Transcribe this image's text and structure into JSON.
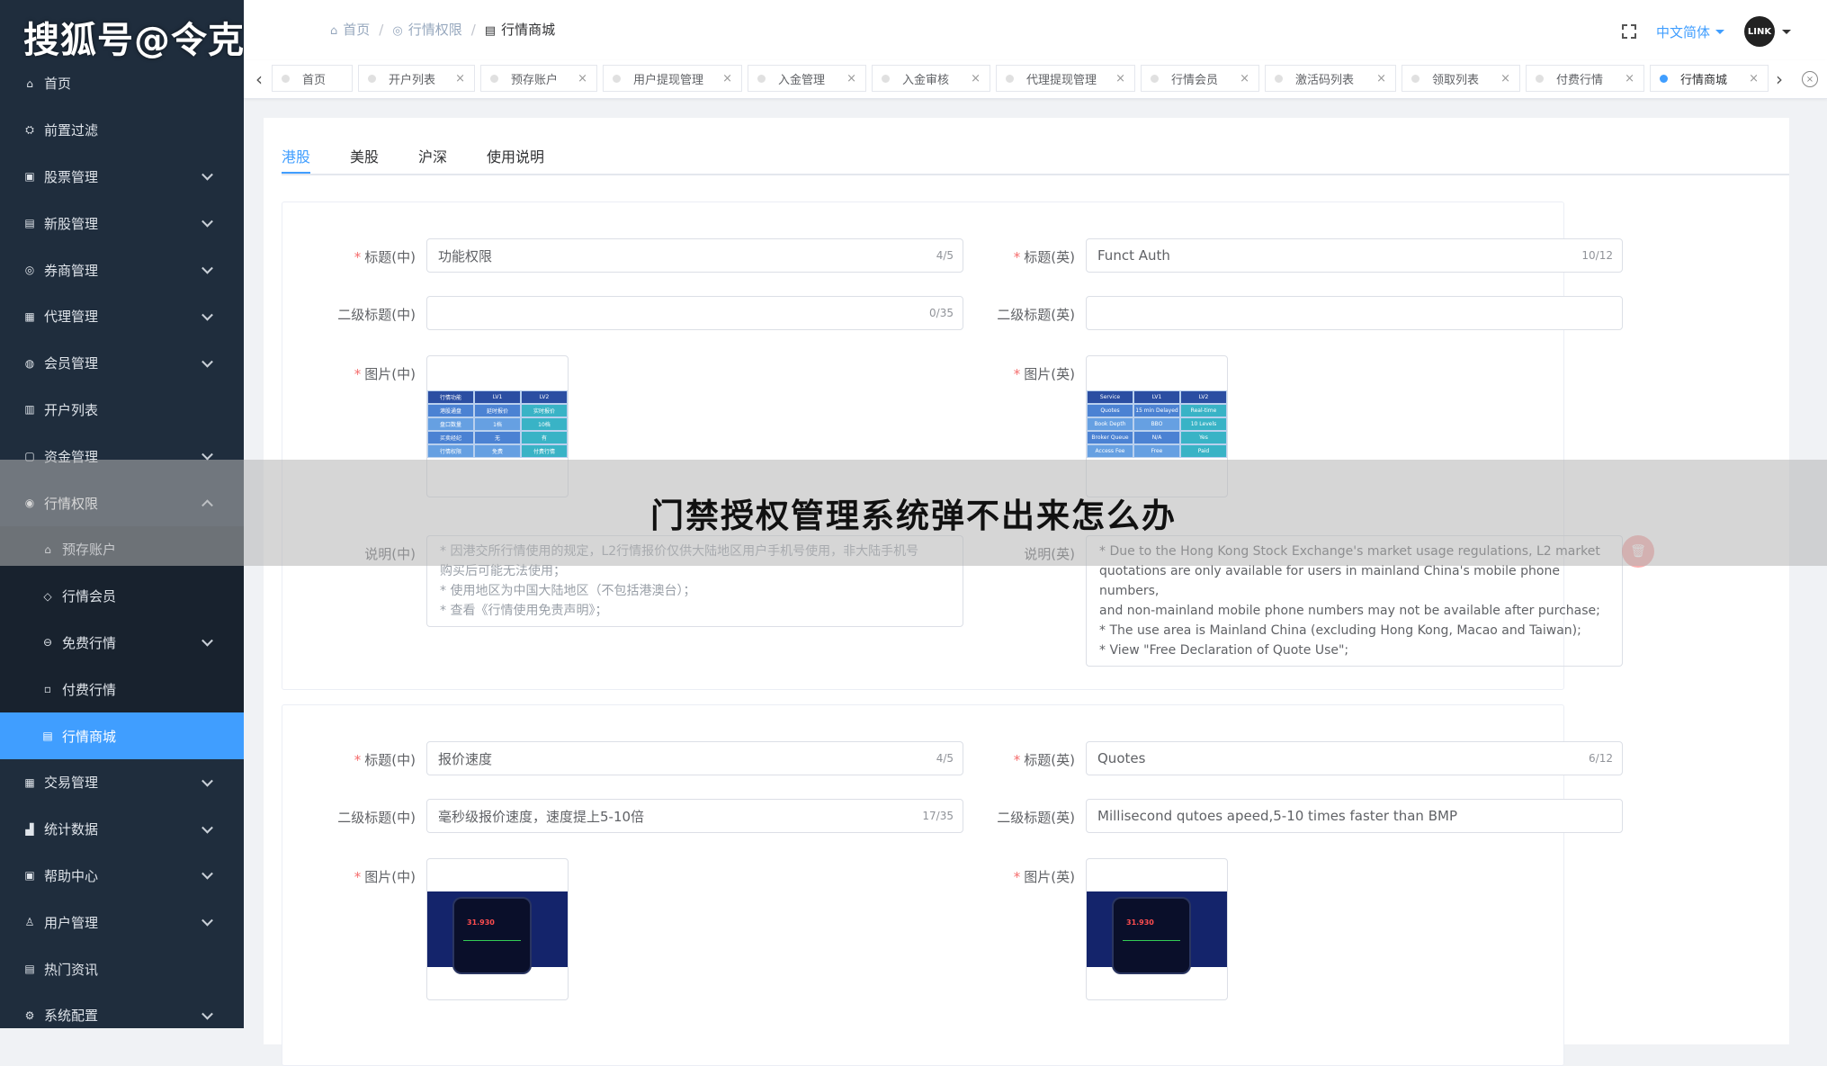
{
  "watermark": "搜狐号@令克软件",
  "overlay_title": "门禁授权管理系统弹不出来怎么办",
  "sidebar": {
    "items": [
      {
        "label": "首页",
        "icon": "home-icon",
        "glyph": "⌂",
        "chevron": false
      },
      {
        "label": "前置过滤",
        "icon": "filter-icon",
        "glyph": "⛭",
        "chevron": false
      },
      {
        "label": "股票管理",
        "icon": "stock-icon",
        "glyph": "▣",
        "chevron": true
      },
      {
        "label": "新股管理",
        "icon": "ipo-icon",
        "glyph": "▤",
        "chevron": true
      },
      {
        "label": "券商管理",
        "icon": "broker-icon",
        "glyph": "◎",
        "chevron": true
      },
      {
        "label": "代理管理",
        "icon": "agent-icon",
        "glyph": "▦",
        "chevron": true
      },
      {
        "label": "会员管理",
        "icon": "member-icon",
        "glyph": "◍",
        "chevron": true
      },
      {
        "label": "开户列表",
        "icon": "account-list-icon",
        "glyph": "▥",
        "chevron": false
      },
      {
        "label": "资金管理",
        "icon": "fund-icon",
        "glyph": "▢",
        "chevron": true
      },
      {
        "label": "行情权限",
        "icon": "quote-permission-icon",
        "glyph": "◉",
        "chevron": "up",
        "open": true
      },
      {
        "label": "预存账户",
        "icon": "prestore-icon",
        "glyph": "⌂",
        "sub": true
      },
      {
        "label": "行情会员",
        "icon": "quote-member-icon",
        "glyph": "◇",
        "sub": true
      },
      {
        "label": "免费行情",
        "icon": "free-quote-icon",
        "glyph": "⊖",
        "sub": true,
        "chevron": true
      },
      {
        "label": "付费行情",
        "icon": "paid-quote-icon",
        "glyph": "▫",
        "sub": true
      },
      {
        "label": "行情商城",
        "icon": "quote-mall-icon",
        "glyph": "▤",
        "sub": true,
        "active": true
      },
      {
        "label": "交易管理",
        "icon": "trade-icon",
        "glyph": "▦",
        "chevron": true
      },
      {
        "label": "统计数据",
        "icon": "stats-icon",
        "glyph": "▟",
        "chevron": true
      },
      {
        "label": "帮助中心",
        "icon": "help-icon",
        "glyph": "▣",
        "chevron": true
      },
      {
        "label": "用户管理",
        "icon": "user-icon",
        "glyph": "♙",
        "chevron": true
      },
      {
        "label": "热门资讯",
        "icon": "news-icon",
        "glyph": "▤",
        "chevron": false
      },
      {
        "label": "系统配置",
        "icon": "settings-icon",
        "glyph": "⚙",
        "chevron": true
      }
    ]
  },
  "breadcrumb": [
    {
      "label": "首页",
      "glyph": "⌂"
    },
    {
      "label": "行情权限",
      "glyph": "◎"
    },
    {
      "label": "行情商城",
      "glyph": "▤"
    }
  ],
  "header": {
    "language": "中文简体",
    "avatar_text": "LINK"
  },
  "tags": [
    {
      "label": "首页",
      "closable": false,
      "width": 90
    },
    {
      "label": "开户列表",
      "closable": true,
      "width": 130
    },
    {
      "label": "预存账户",
      "closable": true,
      "width": 130
    },
    {
      "label": "用户提现管理",
      "closable": true,
      "width": 155
    },
    {
      "label": "入金管理",
      "closable": true,
      "width": 132
    },
    {
      "label": "入金审核",
      "closable": true,
      "width": 132
    },
    {
      "label": "代理提现管理",
      "closable": true,
      "width": 155
    },
    {
      "label": "行情会员",
      "closable": true,
      "width": 132
    },
    {
      "label": "激活码列表",
      "closable": true,
      "width": 146
    },
    {
      "label": "领取列表",
      "closable": true,
      "width": 132
    },
    {
      "label": "付费行情",
      "closable": true,
      "width": 132
    },
    {
      "label": "行情商城",
      "closable": true,
      "width": 132,
      "active": true
    }
  ],
  "tabs": [
    {
      "label": "港股",
      "active": true
    },
    {
      "label": "美股"
    },
    {
      "label": "沪深"
    },
    {
      "label": "使用说明"
    }
  ],
  "labels": {
    "title_cn": "标题(中)",
    "title_en": "标题(英)",
    "subtitle_cn": "二级标题(中)",
    "subtitle_en": "二级标题(英)",
    "image_cn": "图片(中)",
    "image_en": "图片(英)",
    "desc_cn": "说明(中)",
    "desc_en": "说明(英)",
    "required_mark": "*"
  },
  "sections": [
    {
      "title_cn": {
        "value": "功能权限",
        "count": "4/5"
      },
      "title_en": {
        "value": "Funct Auth",
        "count": "10/12"
      },
      "subtitle_cn": {
        "value": "",
        "count": "0/35"
      },
      "subtitle_en": {
        "value": "",
        "count": ""
      },
      "desc_cn": [
        "* 因港交所行情使用的规定，L2行情报价仅供大陆地区用户手机号使用，非大陆手机号",
        "购买后可能无法使用；",
        "* 使用地区为中国大陆地区（不包括港澳台）；",
        "* 查看《行情使用免责声明》；"
      ],
      "desc_en": [
        "* Due to the Hong Kong Stock Exchange's market usage regulations, L2 market",
        "quotations are only available for users in mainland China's mobile phone numbers,",
        "and non-mainland mobile phone numbers may not be available after purchase;",
        "* The use area is Mainland China (excluding Hong Kong, Macao and Taiwan);",
        "* View \"Free Declaration of Quote Use\";"
      ]
    },
    {
      "title_cn": {
        "value": "报价速度",
        "count": "4/5"
      },
      "title_en": {
        "value": "Quotes",
        "count": "6/12"
      },
      "subtitle_cn": {
        "value": "毫秒级报价速度，速度提上5-10倍",
        "count": "17/35"
      },
      "subtitle_en": {
        "value": "Millisecond qutoes apeed,5-10 times faster than BMP",
        "count": ""
      }
    }
  ],
  "thumb_cn": {
    "rows": [
      [
        "行情功能",
        "LV1",
        "LV2"
      ],
      [
        "港股通盘",
        "延时报价",
        "实时报价"
      ],
      [
        "盘口数量",
        "1档",
        "10档"
      ],
      [
        "买卖经纪",
        "无",
        "有"
      ],
      [
        "行情权限",
        "免费",
        "付费行情"
      ]
    ]
  },
  "thumb_en": {
    "rows": [
      [
        "Service",
        "LV1",
        "LV2"
      ],
      [
        "Quotes",
        "15 min Delayed",
        "Real-time"
      ],
      [
        "Book Depth",
        "BBO",
        "10 Levels"
      ],
      [
        "Broker Queue",
        "N/A",
        "Yes"
      ],
      [
        "Access Fee",
        "Free",
        "Paid"
      ]
    ]
  },
  "phone_cn": {
    "price": "31.930"
  },
  "phone_en": {
    "price": "31.930"
  },
  "colors": {
    "sidebar_bg": "#1f2d3d",
    "accent": "#409eff",
    "danger": "#f56c6c"
  }
}
